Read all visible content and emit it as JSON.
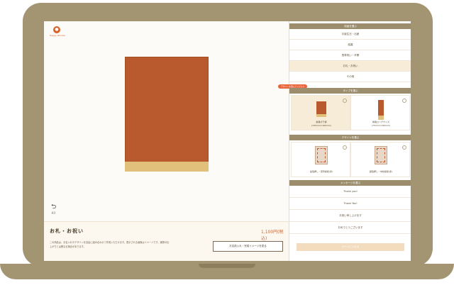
{
  "brand": {
    "logo_text": "Happy Wonder"
  },
  "left": {
    "undo_label": "戻る",
    "product_title": "お札・お祝い",
    "price": "1,100円(税込)",
    "description": "この商品は、お名入れやデザインを自由に組み合わせて作成いただけます。表示される画像はイメージです。実際の仕上がりとは異なる場合があります。",
    "design_button": "お名前入れ・完成イメージを見る"
  },
  "right": {
    "section_color": "用途を選ぶ",
    "colors": [
      "お誕生日・出産",
      "結婚",
      "長寿祝い・卒業",
      "お礼・お祝い",
      "その他"
    ],
    "selected_color_index": 3,
    "callout": "デザインを選んでください",
    "section_type": "タイプを選ぶ",
    "types": [
      {
        "label": "縦長ポチ袋",
        "size": "(105mm×180mm)"
      },
      {
        "label": "横長ロングサイズ",
        "size": "(75mm×190mm)"
      }
    ],
    "section_design": "デザインを選ぶ",
    "designs": [
      {
        "label": "金箔押し・唐草模様(赤)"
      },
      {
        "label": "銀箔押し・市松模様(赤)"
      }
    ],
    "section_message": "メッセージを選ぶ",
    "messages": [
      "Thank you!",
      "Thank You!",
      "お祝い申し上げます",
      "おめでとうございます"
    ],
    "cart_button": "カートに入れる"
  }
}
